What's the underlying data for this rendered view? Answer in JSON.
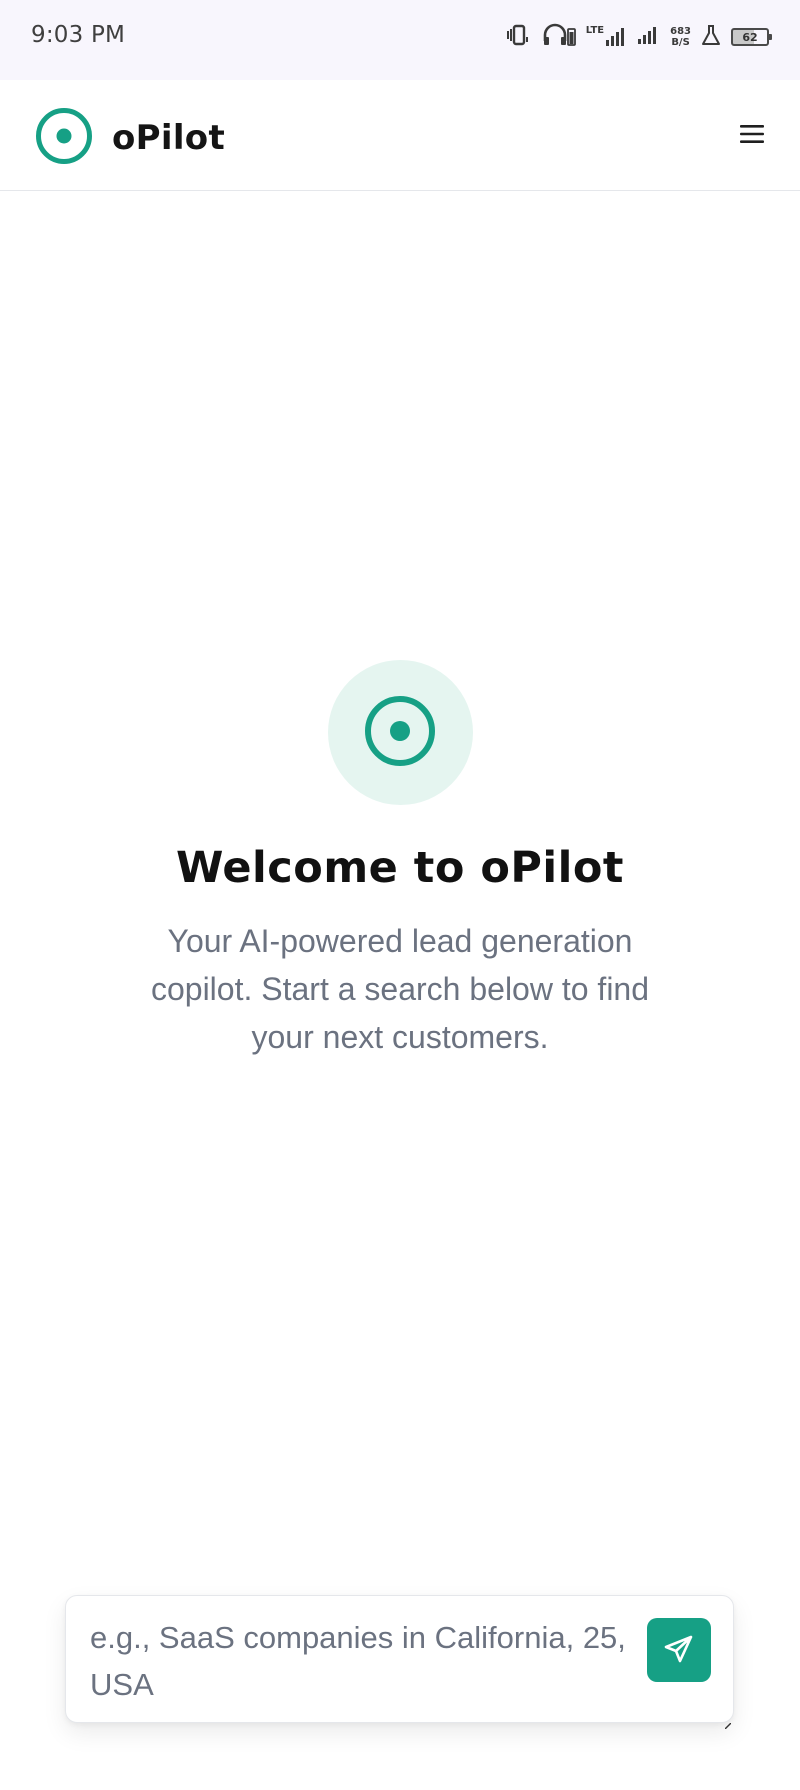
{
  "status_bar": {
    "time": "9:03 PM",
    "net_speed_value": "683",
    "net_speed_unit": "B/S",
    "network_label": "LTE",
    "battery": "62"
  },
  "header": {
    "app_name": "oPilot",
    "menu_icon": "hamburger-menu-icon"
  },
  "hero": {
    "title": "Welcome to oPilot",
    "subtitle": "Your AI-powered lead generation copilot. Start a search below to find your next customers."
  },
  "search": {
    "placeholder": "e.g., SaaS companies in California, 25, USA",
    "value": "",
    "send_icon": "send-icon"
  },
  "colors": {
    "brand": "#16a085",
    "badge_bg": "#e5f5f0",
    "status_bar_bg": "#f8f6fd"
  }
}
